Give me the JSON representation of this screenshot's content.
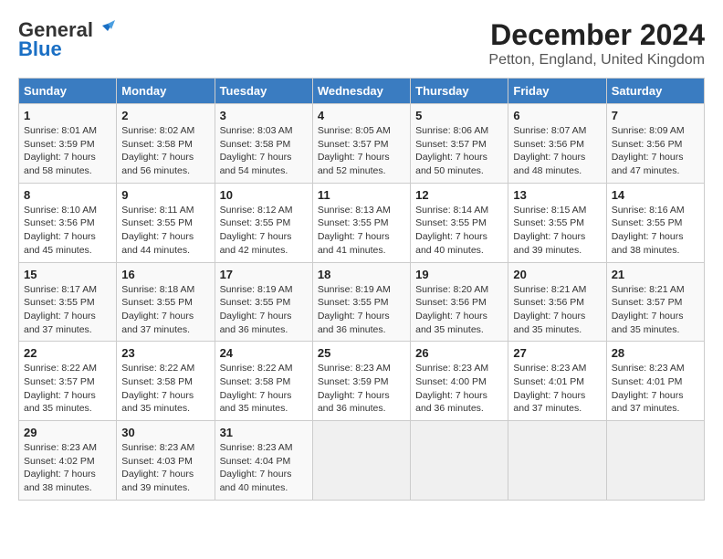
{
  "header": {
    "logo_line1": "General",
    "logo_line2": "Blue",
    "month": "December 2024",
    "location": "Petton, England, United Kingdom"
  },
  "days_of_week": [
    "Sunday",
    "Monday",
    "Tuesday",
    "Wednesday",
    "Thursday",
    "Friday",
    "Saturday"
  ],
  "weeks": [
    [
      {
        "day": "1",
        "sunrise": "8:01 AM",
        "sunset": "3:59 PM",
        "daylight": "7 hours and 58 minutes."
      },
      {
        "day": "2",
        "sunrise": "8:02 AM",
        "sunset": "3:58 PM",
        "daylight": "7 hours and 56 minutes."
      },
      {
        "day": "3",
        "sunrise": "8:03 AM",
        "sunset": "3:58 PM",
        "daylight": "7 hours and 54 minutes."
      },
      {
        "day": "4",
        "sunrise": "8:05 AM",
        "sunset": "3:57 PM",
        "daylight": "7 hours and 52 minutes."
      },
      {
        "day": "5",
        "sunrise": "8:06 AM",
        "sunset": "3:57 PM",
        "daylight": "7 hours and 50 minutes."
      },
      {
        "day": "6",
        "sunrise": "8:07 AM",
        "sunset": "3:56 PM",
        "daylight": "7 hours and 48 minutes."
      },
      {
        "day": "7",
        "sunrise": "8:09 AM",
        "sunset": "3:56 PM",
        "daylight": "7 hours and 47 minutes."
      }
    ],
    [
      {
        "day": "8",
        "sunrise": "8:10 AM",
        "sunset": "3:56 PM",
        "daylight": "7 hours and 45 minutes."
      },
      {
        "day": "9",
        "sunrise": "8:11 AM",
        "sunset": "3:55 PM",
        "daylight": "7 hours and 44 minutes."
      },
      {
        "day": "10",
        "sunrise": "8:12 AM",
        "sunset": "3:55 PM",
        "daylight": "7 hours and 42 minutes."
      },
      {
        "day": "11",
        "sunrise": "8:13 AM",
        "sunset": "3:55 PM",
        "daylight": "7 hours and 41 minutes."
      },
      {
        "day": "12",
        "sunrise": "8:14 AM",
        "sunset": "3:55 PM",
        "daylight": "7 hours and 40 minutes."
      },
      {
        "day": "13",
        "sunrise": "8:15 AM",
        "sunset": "3:55 PM",
        "daylight": "7 hours and 39 minutes."
      },
      {
        "day": "14",
        "sunrise": "8:16 AM",
        "sunset": "3:55 PM",
        "daylight": "7 hours and 38 minutes."
      }
    ],
    [
      {
        "day": "15",
        "sunrise": "8:17 AM",
        "sunset": "3:55 PM",
        "daylight": "7 hours and 37 minutes."
      },
      {
        "day": "16",
        "sunrise": "8:18 AM",
        "sunset": "3:55 PM",
        "daylight": "7 hours and 37 minutes."
      },
      {
        "day": "17",
        "sunrise": "8:19 AM",
        "sunset": "3:55 PM",
        "daylight": "7 hours and 36 minutes."
      },
      {
        "day": "18",
        "sunrise": "8:19 AM",
        "sunset": "3:55 PM",
        "daylight": "7 hours and 36 minutes."
      },
      {
        "day": "19",
        "sunrise": "8:20 AM",
        "sunset": "3:56 PM",
        "daylight": "7 hours and 35 minutes."
      },
      {
        "day": "20",
        "sunrise": "8:21 AM",
        "sunset": "3:56 PM",
        "daylight": "7 hours and 35 minutes."
      },
      {
        "day": "21",
        "sunrise": "8:21 AM",
        "sunset": "3:57 PM",
        "daylight": "7 hours and 35 minutes."
      }
    ],
    [
      {
        "day": "22",
        "sunrise": "8:22 AM",
        "sunset": "3:57 PM",
        "daylight": "7 hours and 35 minutes."
      },
      {
        "day": "23",
        "sunrise": "8:22 AM",
        "sunset": "3:58 PM",
        "daylight": "7 hours and 35 minutes."
      },
      {
        "day": "24",
        "sunrise": "8:22 AM",
        "sunset": "3:58 PM",
        "daylight": "7 hours and 35 minutes."
      },
      {
        "day": "25",
        "sunrise": "8:23 AM",
        "sunset": "3:59 PM",
        "daylight": "7 hours and 36 minutes."
      },
      {
        "day": "26",
        "sunrise": "8:23 AM",
        "sunset": "4:00 PM",
        "daylight": "7 hours and 36 minutes."
      },
      {
        "day": "27",
        "sunrise": "8:23 AM",
        "sunset": "4:01 PM",
        "daylight": "7 hours and 37 minutes."
      },
      {
        "day": "28",
        "sunrise": "8:23 AM",
        "sunset": "4:01 PM",
        "daylight": "7 hours and 37 minutes."
      }
    ],
    [
      {
        "day": "29",
        "sunrise": "8:23 AM",
        "sunset": "4:02 PM",
        "daylight": "7 hours and 38 minutes."
      },
      {
        "day": "30",
        "sunrise": "8:23 AM",
        "sunset": "4:03 PM",
        "daylight": "7 hours and 39 minutes."
      },
      {
        "day": "31",
        "sunrise": "8:23 AM",
        "sunset": "4:04 PM",
        "daylight": "7 hours and 40 minutes."
      },
      null,
      null,
      null,
      null
    ]
  ]
}
